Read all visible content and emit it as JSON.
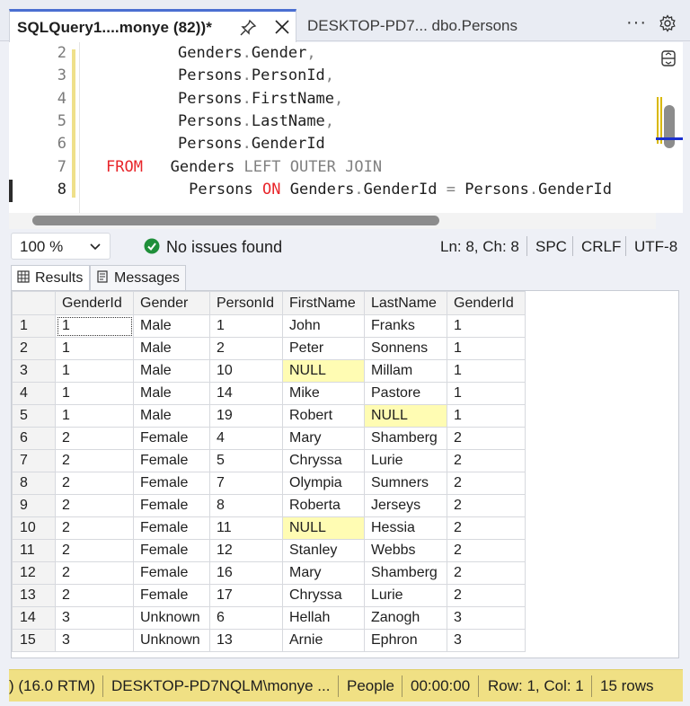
{
  "tabs": {
    "active_title": "SQLQuery1....monye (82))*",
    "inactive_title": "DESKTOP-PD7... dbo.Persons",
    "menu_glyph": "···"
  },
  "editor": {
    "lines": [
      {
        "num": "2",
        "tokens": [
          [
            "ident",
            "Genders"
          ],
          [
            "gray",
            "."
          ],
          [
            "ident",
            "Gender"
          ],
          [
            "gray",
            ","
          ]
        ]
      },
      {
        "num": "3",
        "tokens": [
          [
            "ident",
            "Persons"
          ],
          [
            "gray",
            "."
          ],
          [
            "ident",
            "PersonId"
          ],
          [
            "gray",
            ","
          ]
        ]
      },
      {
        "num": "4",
        "tokens": [
          [
            "ident",
            "Persons"
          ],
          [
            "gray",
            "."
          ],
          [
            "ident",
            "FirstName"
          ],
          [
            "gray",
            ","
          ]
        ]
      },
      {
        "num": "5",
        "tokens": [
          [
            "ident",
            "Persons"
          ],
          [
            "gray",
            "."
          ],
          [
            "ident",
            "LastName"
          ],
          [
            "gray",
            ","
          ]
        ]
      },
      {
        "num": "6",
        "tokens": [
          [
            "ident",
            "Persons"
          ],
          [
            "gray",
            "."
          ],
          [
            "ident",
            "GenderId"
          ]
        ]
      },
      {
        "num": "7",
        "tokens": [
          [
            "kwr",
            "FROM"
          ],
          [
            "ident",
            "   Genders "
          ],
          [
            "gray",
            "LEFT OUTER JOIN"
          ]
        ]
      },
      {
        "num": "8",
        "tokens": [
          [
            "ident",
            "         Persons "
          ],
          [
            "kwr",
            "ON"
          ],
          [
            "ident",
            " Genders"
          ],
          [
            "gray",
            "."
          ],
          [
            "ident",
            "GenderId "
          ],
          [
            "gray",
            "="
          ],
          [
            "ident",
            " Persons"
          ],
          [
            "gray",
            "."
          ],
          [
            "ident",
            "GenderId"
          ]
        ]
      }
    ]
  },
  "editor_status": {
    "zoom": "100 %",
    "issues": "No issues found",
    "position": "Ln: 8, Ch: 8",
    "whitespace": "SPC",
    "line_ending": "CRLF",
    "encoding": "UTF-8"
  },
  "results": {
    "tab_results": "Results",
    "tab_messages": "Messages",
    "columns": [
      "GenderId",
      "Gender",
      "PersonId",
      "FirstName",
      "LastName",
      "GenderId"
    ],
    "rows": [
      [
        "1",
        "1",
        "Male",
        "1",
        "John",
        "Franks",
        "1"
      ],
      [
        "2",
        "1",
        "Male",
        "2",
        "Peter",
        "Sonnens",
        "1"
      ],
      [
        "3",
        "1",
        "Male",
        "10",
        "NULL",
        "Millam",
        "1"
      ],
      [
        "4",
        "1",
        "Male",
        "14",
        "Mike",
        "Pastore",
        "1"
      ],
      [
        "5",
        "1",
        "Male",
        "19",
        "Robert",
        "NULL",
        "1"
      ],
      [
        "6",
        "2",
        "Female",
        "4",
        "Mary",
        "Shamberg",
        "2"
      ],
      [
        "7",
        "2",
        "Female",
        "5",
        "Chryssa",
        "Lurie",
        "2"
      ],
      [
        "8",
        "2",
        "Female",
        "7",
        "Olympia",
        "Sumners",
        "2"
      ],
      [
        "9",
        "2",
        "Female",
        "8",
        "Roberta",
        "Jerseys",
        "2"
      ],
      [
        "10",
        "2",
        "Female",
        "11",
        "NULL",
        "Hessia",
        "2"
      ],
      [
        "11",
        "2",
        "Female",
        "12",
        "Stanley",
        "Webbs",
        "2"
      ],
      [
        "12",
        "2",
        "Female",
        "16",
        "Mary",
        "Shamberg",
        "2"
      ],
      [
        "13",
        "2",
        "Female",
        "17",
        "Chryssa",
        "Lurie",
        "2"
      ],
      [
        "14",
        "3",
        "Unknown",
        "6",
        "Hellah",
        "Zanogh",
        "3"
      ],
      [
        "15",
        "3",
        "Unknown",
        "13",
        "Arnie",
        "Ephron",
        "3"
      ]
    ]
  },
  "statusbar": {
    "version": ") (16.0 RTM)",
    "server_user": "DESKTOP-PD7NQLM\\monye ...",
    "database": "People",
    "elapsed": "00:00:00",
    "rowcol": "Row: 1, Col: 1",
    "rowcount": "15 rows"
  },
  "colors": {
    "status_bg": "#f0e084",
    "null_bg": "#fffcb3",
    "keyword_red": "#e8262b",
    "tab_accent": "#4a6fd1"
  }
}
